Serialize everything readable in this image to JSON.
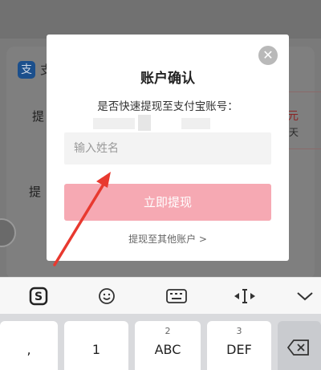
{
  "background": {
    "alipay_text": "支",
    "row1_label": "提",
    "row2_label": "提",
    "amount_text": "元",
    "amount_sub": "天"
  },
  "dialog": {
    "title": "账户确认",
    "subtitle": "是否快速提现至支付宝账号：",
    "name_placeholder": "输入姓名",
    "submit_label": "立即提现",
    "other_account_link": "提现至其他账户 >",
    "close_symbol": "✕"
  },
  "keyboard": {
    "toolbar": [
      {
        "name": "sogou-logo-icon",
        "glyph": "S"
      },
      {
        "name": "emoji-icon",
        "glyph": "☺"
      },
      {
        "name": "keyboard-icon",
        "glyph": "⌨"
      },
      {
        "name": "cursor-move-icon",
        "glyph": "◂I▸"
      },
      {
        "name": "collapse-icon",
        "glyph": "⌄"
      }
    ],
    "keys": [
      {
        "num": "",
        "main": ","
      },
      {
        "num": "",
        "main": "1"
      },
      {
        "num": "2",
        "main": "ABC"
      },
      {
        "num": "3",
        "main": "DEF"
      }
    ]
  },
  "colors": {
    "submit_button": "#f6a9b3",
    "arrow": "#e8392f"
  }
}
